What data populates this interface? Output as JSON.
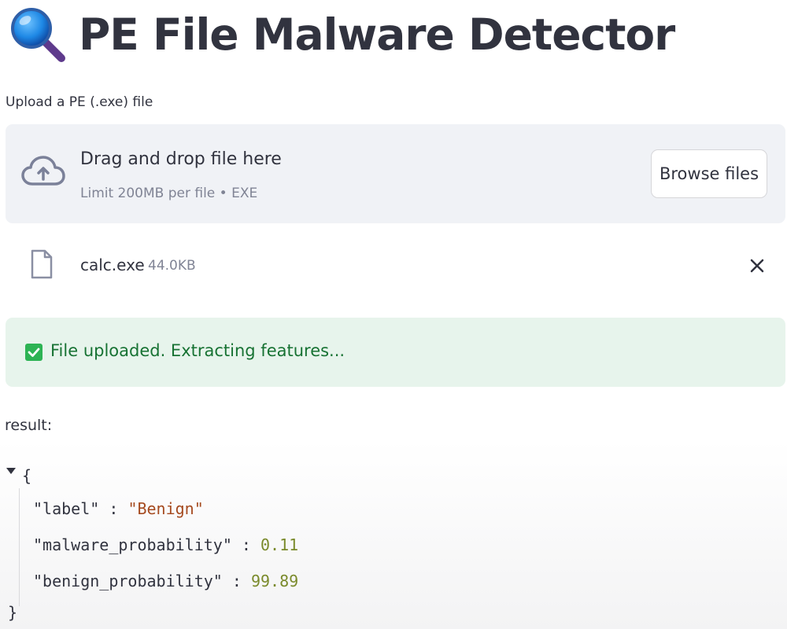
{
  "header": {
    "icon": "magnifying-glass-icon",
    "title": "PE File Malware Detector"
  },
  "uploader": {
    "label": "Upload a PE (.exe) file",
    "dropzone_title": "Drag and drop file here",
    "dropzone_limit": "Limit 200MB per file • EXE",
    "browse_label": "Browse files",
    "icon": "cloud-upload-icon"
  },
  "uploaded_file": {
    "icon": "file-icon",
    "name": "calc.exe",
    "size": "44.0KB",
    "remove_icon": "close-icon"
  },
  "status": {
    "icon": "check-box-icon",
    "message": "File uploaded. Extracting features..."
  },
  "result": {
    "label": "result:",
    "open_brace": "{",
    "close_brace": "}",
    "entries": [
      {
        "key": "\"label\"",
        "value": "\"Benign\""
      },
      {
        "key": "\"malware_probability\"",
        "value": "0.11"
      },
      {
        "key": "\"benign_probability\"",
        "value": "99.89"
      }
    ]
  },
  "colors": {
    "text": "#31333f",
    "muted": "#808495",
    "dropzone_bg": "#f0f2f6",
    "success_bg": "#e7f4ec",
    "success_text": "#177233",
    "json_string": "#a54a1f",
    "json_number": "#7a8a2b"
  }
}
